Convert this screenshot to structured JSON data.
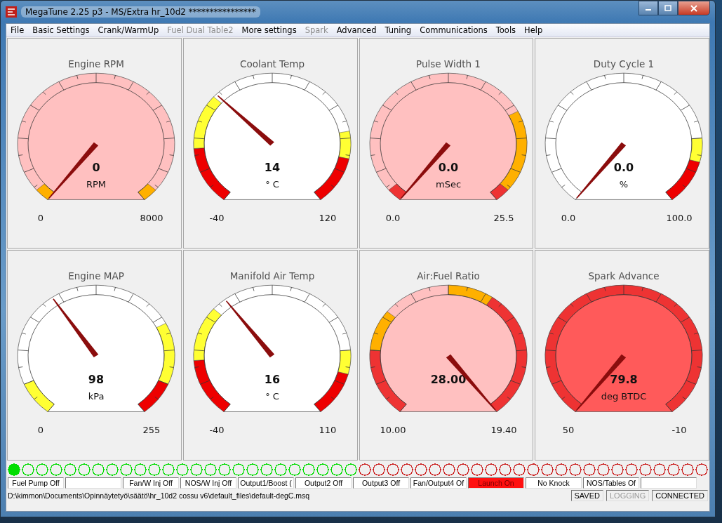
{
  "window": {
    "title": "MegaTune 2.25 p3 - MS/Extra hr_10d2 ****************"
  },
  "menu": [
    {
      "label": "File",
      "disabled": false
    },
    {
      "label": "Basic Settings",
      "disabled": false
    },
    {
      "label": "Crank/WarmUp",
      "disabled": false
    },
    {
      "label": "Fuel Dual Table2",
      "disabled": true
    },
    {
      "label": "More settings",
      "disabled": false
    },
    {
      "label": "Spark",
      "disabled": true
    },
    {
      "label": "Advanced",
      "disabled": false
    },
    {
      "label": "Tuning",
      "disabled": false
    },
    {
      "label": "Communications",
      "disabled": false
    },
    {
      "label": "Tools",
      "disabled": false
    },
    {
      "label": "Help",
      "disabled": false
    }
  ],
  "gauges": [
    {
      "title": "Engine RPM",
      "value": "0",
      "unit": "RPM",
      "min": "0",
      "max": "8000"
    },
    {
      "title": "Coolant Temp",
      "value": "14",
      "unit": "° C",
      "min": "-40",
      "max": "120"
    },
    {
      "title": "Pulse Width 1",
      "value": "0.0",
      "unit": "mSec",
      "min": "0.0",
      "max": "25.5"
    },
    {
      "title": "Duty Cycle 1",
      "value": "0.0",
      "unit": "%",
      "min": "0.0",
      "max": "100.0"
    },
    {
      "title": "Engine MAP",
      "value": "98",
      "unit": "kPa",
      "min": "0",
      "max": "255"
    },
    {
      "title": "Manifold Air Temp",
      "value": "16",
      "unit": "° C",
      "min": "-40",
      "max": "110"
    },
    {
      "title": "Air:Fuel Ratio",
      "value": "28.00",
      "min": "10.00",
      "max": "19.40"
    },
    {
      "title": "Spark Advance",
      "value": "79.8",
      "unit": "deg BTDC",
      "min": "50",
      "max": "-10"
    }
  ],
  "lights": [
    {
      "color": "#00dd00",
      "on": true
    },
    {
      "color": "#00dd00",
      "on": false
    },
    {
      "color": "#00dd00",
      "on": false
    },
    {
      "color": "#00dd00",
      "on": false
    },
    {
      "color": "#00dd00",
      "on": false
    },
    {
      "color": "#00dd00",
      "on": false
    },
    {
      "color": "#00dd00",
      "on": false
    },
    {
      "color": "#00dd00",
      "on": false
    },
    {
      "color": "#00dd00",
      "on": false
    },
    {
      "color": "#00dd00",
      "on": false
    },
    {
      "color": "#00dd00",
      "on": false
    },
    {
      "color": "#00dd00",
      "on": false
    },
    {
      "color": "#00dd00",
      "on": false
    },
    {
      "color": "#00dd00",
      "on": false
    },
    {
      "color": "#00dd00",
      "on": false
    },
    {
      "color": "#00dd00",
      "on": false
    },
    {
      "color": "#00dd00",
      "on": false
    },
    {
      "color": "#00dd00",
      "on": false
    },
    {
      "color": "#00dd00",
      "on": false
    },
    {
      "color": "#00dd00",
      "on": false
    },
    {
      "color": "#00dd00",
      "on": false
    },
    {
      "color": "#00dd00",
      "on": false
    },
    {
      "color": "#00dd00",
      "on": false
    },
    {
      "color": "#00dd00",
      "on": false
    },
    {
      "color": "#00dd00",
      "on": false
    },
    {
      "color": "#cc2222",
      "on": false
    },
    {
      "color": "#cc2222",
      "on": false
    },
    {
      "color": "#cc2222",
      "on": false
    },
    {
      "color": "#cc2222",
      "on": false
    },
    {
      "color": "#cc2222",
      "on": false
    },
    {
      "color": "#cc2222",
      "on": false
    },
    {
      "color": "#cc2222",
      "on": false
    },
    {
      "color": "#cc2222",
      "on": false
    },
    {
      "color": "#cc2222",
      "on": false
    },
    {
      "color": "#cc2222",
      "on": false
    },
    {
      "color": "#cc2222",
      "on": false
    },
    {
      "color": "#cc2222",
      "on": false
    },
    {
      "color": "#cc2222",
      "on": false
    },
    {
      "color": "#cc2222",
      "on": false
    },
    {
      "color": "#cc2222",
      "on": false
    },
    {
      "color": "#cc2222",
      "on": false
    },
    {
      "color": "#cc2222",
      "on": false
    },
    {
      "color": "#cc2222",
      "on": false
    },
    {
      "color": "#cc2222",
      "on": false
    },
    {
      "color": "#cc2222",
      "on": false
    },
    {
      "color": "#cc2222",
      "on": false
    },
    {
      "color": "#cc2222",
      "on": false
    },
    {
      "color": "#cc2222",
      "on": false
    },
    {
      "color": "#cc2222",
      "on": false
    },
    {
      "color": "#cc2222",
      "on": false
    }
  ],
  "indicators": [
    {
      "text": "Fuel Pump Off",
      "active": false
    },
    {
      "active": false
    },
    {
      "text": "Fan/W Inj Off",
      "active": false
    },
    {
      "text": "NOS/W Inj Off",
      "active": false
    },
    {
      "text": "Output1/Boost (",
      "active": false
    },
    {
      "text": "Output2 Off",
      "active": false
    },
    {
      "text": "Output3 Off",
      "active": false
    },
    {
      "text": "Fan/Output4 Of",
      "active": false
    },
    {
      "text": "Launch On",
      "active": true
    },
    {
      "text": "No Knock",
      "active": false
    },
    {
      "text": "NOS/Tables Of",
      "active": false
    },
    {
      "active": false
    }
  ],
  "status_bar": {
    "path": "D:\\kimmon\\Documents\\Opinnäytetyö\\säätö\\hr_10d2 cossu v6\\default_files\\default-degC.msq",
    "flags": [
      {
        "label": "SAVED",
        "disabled": false
      },
      {
        "label": "LOGGING",
        "disabled": true
      },
      {
        "label": "CONNECTED",
        "disabled": false
      }
    ]
  }
}
